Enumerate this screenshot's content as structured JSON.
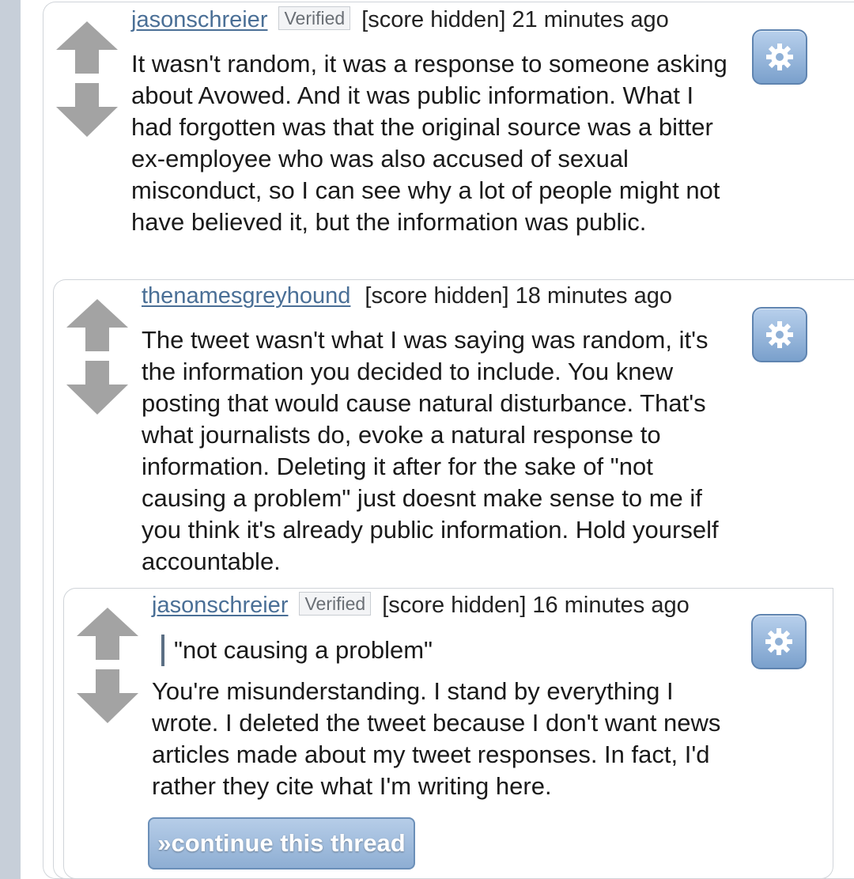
{
  "comments": [
    {
      "author": "jasonschreier",
      "badge": "Verified",
      "meta": "[score hidden] 21 minutes ago",
      "body": "It wasn't random, it was a response to someone asking about Avowed. And it was public information. What I had forgotten was that the original source was a bitter ex-employee who was also accused of sexual misconduct, so I can see why a lot of people might not have believed it, but the information was public."
    },
    {
      "author": "thenamesgreyhound",
      "meta": "[score hidden] 18 minutes ago",
      "body": "The tweet wasn't what I was saying was random, it's the information you decided to include. You knew posting that would cause natural disturbance. That's what journalists do, evoke a natural response to information. Deleting it after for the sake of \"not causing a problem\" just doesnt make sense to me if you think it's already public information. Hold yourself accountable."
    },
    {
      "author": "jasonschreier",
      "badge": "Verified",
      "meta": "[score hidden] 16 minutes ago",
      "quote": "\"not causing a problem\"",
      "body": "You're misunderstanding. I stand by everything I wrote. I deleted the tweet because I don't want news articles made about my tweet responses. In fact, I'd rather they cite what I'm writing here."
    }
  ],
  "continue_label": "»continue this thread",
  "icons": {
    "upvote": "upvote-arrow-icon",
    "downvote": "downvote-arrow-icon",
    "settings": "gear-icon"
  },
  "colors": {
    "author_link": "#4a6f96",
    "button_blue": "#8eaed3",
    "arrow_gray": "#a3a3a3"
  }
}
